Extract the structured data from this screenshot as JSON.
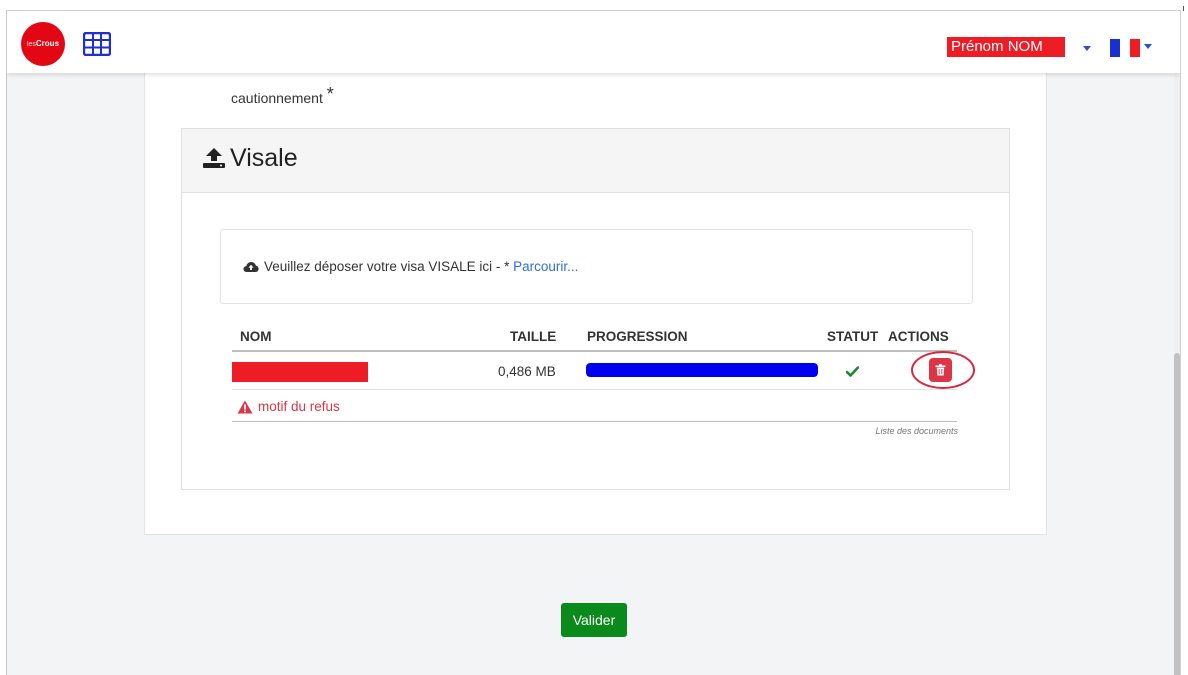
{
  "header": {
    "logo_text_small": "les",
    "logo_text": "Crous",
    "user_name": "Prénom NOM",
    "colors": {
      "logo": "#e30613",
      "user_badge": "#ee1c25",
      "caret": "#2a4fd6"
    }
  },
  "form": {
    "caution_label": "cautionnement",
    "required_star": "*"
  },
  "visale": {
    "title": "Visale",
    "dropzone": {
      "text": "Veuillez déposer votre visa VISALE ici - * ",
      "browse_link": "Parcourir..."
    },
    "table": {
      "headers": {
        "name": "NOM",
        "size": "TAILLE",
        "progress": "PROGRESSION",
        "status": "STATUT",
        "actions": "ACTIONS"
      },
      "rows": [
        {
          "size": "0,486 MB",
          "progress_percent": 100,
          "status": "ok"
        }
      ],
      "refusal_text": "motif du refus",
      "caption": "Liste des documents"
    }
  },
  "footer": {
    "submit_label": "Valider"
  },
  "icons": [
    "grid-icon",
    "chevron-down-icon",
    "flag-fr-icon",
    "upload-icon",
    "cloud-upload-icon",
    "check-icon",
    "trash-icon",
    "warning-icon"
  ]
}
